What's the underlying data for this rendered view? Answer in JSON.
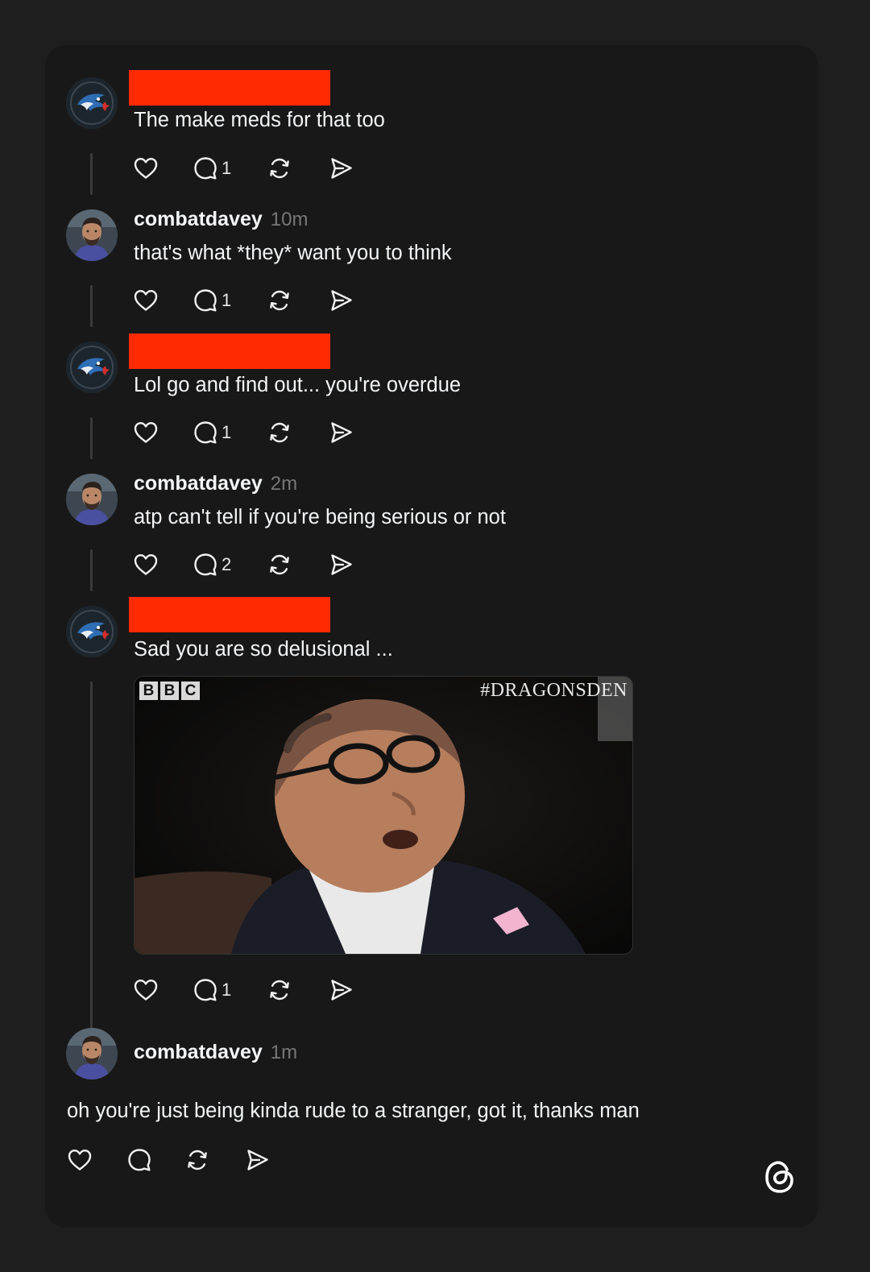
{
  "posts": [
    {
      "redacted": true,
      "text": "The make meds for that too",
      "counts": {
        "reply": "1"
      },
      "avatar": "blue-jays-logo"
    },
    {
      "username": "combatdavey",
      "time": "10m",
      "text": "that's what *they* want you to think",
      "counts": {
        "reply": "1"
      },
      "avatar": "profile-photo"
    },
    {
      "redacted": true,
      "text": "Lol go and find out... you're overdue",
      "counts": {
        "reply": "1"
      },
      "avatar": "blue-jays-logo"
    },
    {
      "username": "combatdavey",
      "time": "2m",
      "text": "atp can't tell if you're being serious or not",
      "counts": {
        "reply": "2"
      },
      "avatar": "profile-photo"
    },
    {
      "redacted": true,
      "text": "Sad you are so delusional ...",
      "counts": {
        "reply": "1"
      },
      "avatar": "blue-jays-logo",
      "gif": {
        "broadcaster": [
          "B",
          "B",
          "C"
        ],
        "hashtag": "#DRAGONSDEN"
      }
    },
    {
      "username": "combatdavey",
      "time": "1m",
      "text": "oh you're just being kinda rude to a stranger, got it, thanks man",
      "avatar": "profile-photo"
    }
  ],
  "icons": {
    "like": "heart-icon",
    "reply": "comment-icon",
    "repost": "repost-icon",
    "share": "send-icon",
    "brand": "threads-logo-icon"
  },
  "colors": {
    "background": "#1e1e1f",
    "card": "#181818",
    "redaction": "#ff2a00",
    "text": "#f3f5f7",
    "muted": "#777777",
    "thread_line": "#3a3a3a"
  }
}
